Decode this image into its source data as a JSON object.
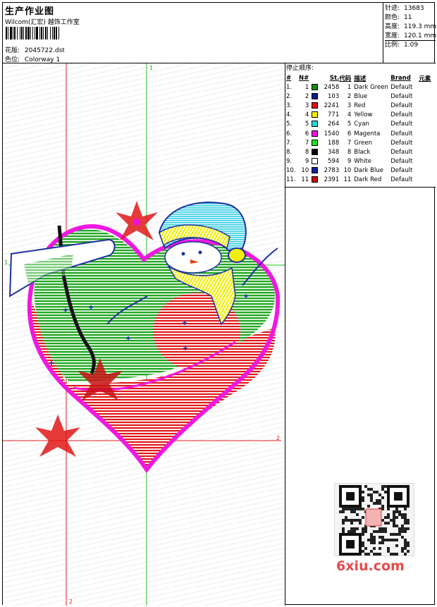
{
  "header": {
    "title": "生产作业图",
    "company": "Wilcom(汇宏) 越饰工作室",
    "design_label": "花版:",
    "design_value": "2045722.dst",
    "colorway_label": "色位:",
    "colorway_value": "Colorway 1"
  },
  "stats": [
    {
      "label": "针迹:",
      "value": "13683"
    },
    {
      "label": "颜色:",
      "value": "11"
    },
    {
      "label": "高度:",
      "value": "119.3 mm"
    },
    {
      "label": "宽度:",
      "value": "120.1 mm"
    },
    {
      "label": "比例:",
      "value": "1.09"
    }
  ],
  "stop_sequence": {
    "title": "停止顺序:",
    "headers": [
      "#",
      "N#",
      "St.",
      "代码",
      "描述",
      "Brand",
      "元素"
    ],
    "rows": [
      {
        "idx": "1.",
        "n": "1",
        "color": "#1a8a1a",
        "st": "2458",
        "code": "1",
        "desc": "Dark Green",
        "brand": "Default"
      },
      {
        "idx": "2.",
        "n": "2",
        "color": "#0a1a8c",
        "st": "103",
        "code": "2",
        "desc": "Blue",
        "brand": "Default"
      },
      {
        "idx": "3.",
        "n": "3",
        "color": "#e01010",
        "st": "2241",
        "code": "3",
        "desc": "Red",
        "brand": "Default"
      },
      {
        "idx": "4.",
        "n": "4",
        "color": "#f4f000",
        "st": "771",
        "code": "4",
        "desc": "Yellow",
        "brand": "Default"
      },
      {
        "idx": "5.",
        "n": "5",
        "color": "#20d8e0",
        "st": "264",
        "code": "5",
        "desc": "Cyan",
        "brand": "Default"
      },
      {
        "idx": "6.",
        "n": "6",
        "color": "#f010e0",
        "st": "1540",
        "code": "6",
        "desc": "Magenta",
        "brand": "Default"
      },
      {
        "idx": "7.",
        "n": "7",
        "color": "#20e020",
        "st": "188",
        "code": "7",
        "desc": "Green",
        "brand": "Default"
      },
      {
        "idx": "8.",
        "n": "8",
        "color": "#000000",
        "st": "348",
        "code": "8",
        "desc": "Black",
        "brand": "Default"
      },
      {
        "idx": "9.",
        "n": "9",
        "color": "#ffffff",
        "st": "594",
        "code": "9",
        "desc": "White",
        "brand": "Default"
      },
      {
        "idx": "10.",
        "n": "10",
        "color": "#1020a0",
        "st": "2783",
        "code": "10",
        "desc": "Dark Blue",
        "brand": "Default"
      },
      {
        "idx": "11.",
        "n": "11",
        "color": "#c01010",
        "st": "2391",
        "code": "11",
        "desc": "Dark Red",
        "brand": "Default"
      }
    ]
  },
  "guides": {
    "label_1": "1",
    "label_2": "2"
  },
  "watermark": {
    "text": "6xiu.com"
  }
}
